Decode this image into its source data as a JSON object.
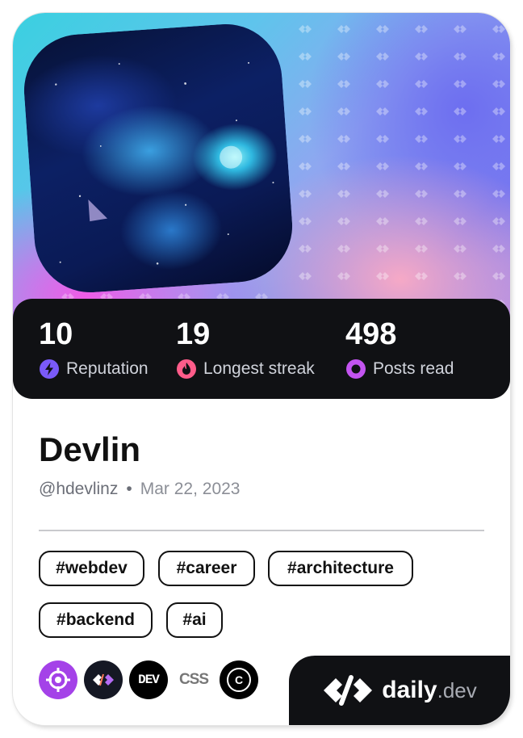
{
  "profile": {
    "name": "Devlin",
    "handle": "@hdevlinz",
    "separator": "•",
    "joined": "Mar 22, 2023"
  },
  "stats": [
    {
      "value": "10",
      "label": "Reputation",
      "icon": "bolt-icon",
      "color": "#7a5af8"
    },
    {
      "value": "19",
      "label": "Longest streak",
      "icon": "flame-icon",
      "color": "#ff5c8a"
    },
    {
      "value": "498",
      "label": "Posts read",
      "icon": "eye-ring-icon",
      "color": "#c354f0"
    }
  ],
  "tags": [
    "#webdev",
    "#career",
    "#architecture",
    "#backend",
    "#ai"
  ],
  "sources": [
    {
      "name": "target-source-icon",
      "bg": "#a442e8"
    },
    {
      "name": "dailydev-source-icon",
      "bg": "#151824"
    },
    {
      "name": "dev-source-icon",
      "bg": "#000000",
      "text": "DEV"
    },
    {
      "name": "css-source-icon",
      "bg": "#ffffff",
      "text": "CSS"
    },
    {
      "name": "c-source-icon",
      "bg": "#000000",
      "text": "C"
    }
  ],
  "brand": {
    "word_main": "daily",
    "word_suffix": ".dev"
  },
  "colors": {
    "dark": "#101114",
    "text": "#111111",
    "muted": "#6b6e77"
  }
}
